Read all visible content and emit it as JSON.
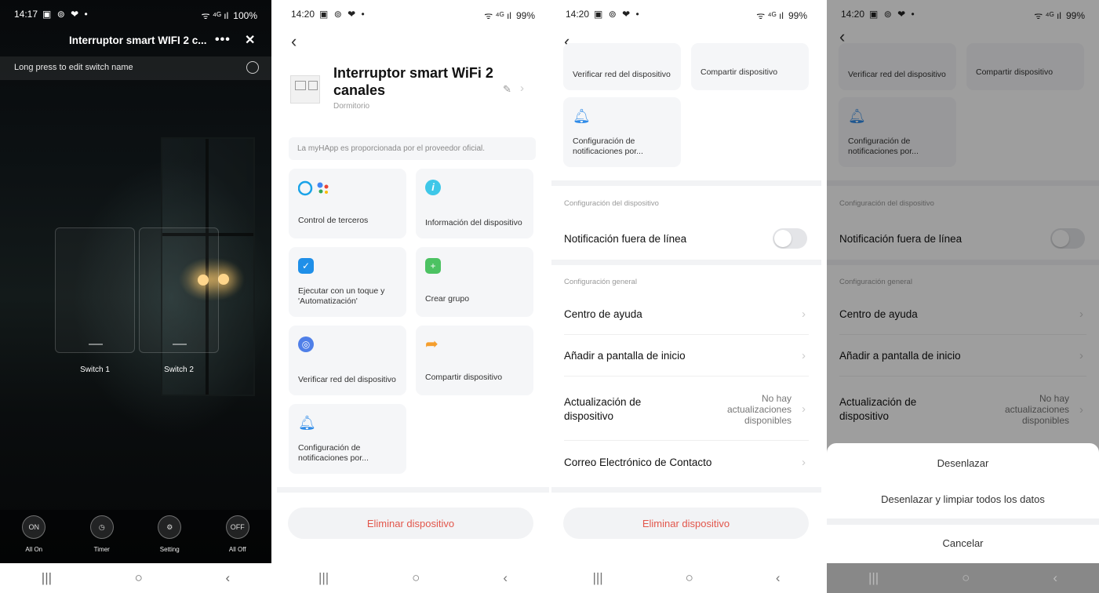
{
  "screen1": {
    "status": {
      "time": "14:17",
      "icons": "▣ ⊚ ❤ •",
      "signal": "ᯤ ⁴ᴳ ıl",
      "battery": "100%"
    },
    "title": "Interruptor smart WIFI 2 c...",
    "more_icon": "•••",
    "close_icon": "✕",
    "hint": "Long press to edit switch name",
    "switches": [
      "Switch 1",
      "Switch 2"
    ],
    "controls": [
      {
        "icon_text": "ON",
        "label": "All On"
      },
      {
        "icon_text": "◷",
        "label": "Timer"
      },
      {
        "icon_text": "⚙",
        "label": "Setting"
      },
      {
        "icon_text": "OFF",
        "label": "All Off"
      }
    ],
    "nav": {
      "recent": "|||",
      "home": "○",
      "back": "‹"
    }
  },
  "screen2": {
    "status": {
      "time": "14:20",
      "icons": "▣ ⊚ ❤ •",
      "signal": "ᯤ ⁴ᴳ ıl",
      "battery": "99%"
    },
    "back_icon": "‹",
    "device_name": "Interruptor smart WiFi 2 canales",
    "device_room": "Dormitorio",
    "edit_icon": "✎",
    "chevron": "›",
    "provider_text": "La myHApp es proporcionada por el proveedor oficial.",
    "tiles": [
      {
        "label": "Control de terceros",
        "icon": "alexa-google-icon",
        "color": "#1a73e8"
      },
      {
        "label": "Información del dispositivo",
        "icon": "info-icon",
        "color": "#3ec7e8"
      },
      {
        "label": "Ejecutar con un toque y 'Automatización'",
        "icon": "check-shield-icon",
        "color": "#1f8fe8"
      },
      {
        "label": "Crear grupo",
        "icon": "group-add-icon",
        "color": "#4cc262"
      },
      {
        "label": "Verificar red del dispositivo",
        "icon": "network-check-icon",
        "color": "#4f7fe8"
      },
      {
        "label": "Compartir dispositivo",
        "icon": "share-arrow-icon",
        "color": "#f59e2d"
      },
      {
        "label": "Configuración de notificaciones por...",
        "icon": "bell-icon",
        "color": "#2f8be8"
      }
    ],
    "delete_label": "Eliminar dispositivo",
    "nav": {
      "recent": "|||",
      "home": "○",
      "back": "‹"
    }
  },
  "screen3": {
    "status": {
      "time": "14:20",
      "icons": "▣ ⊚ ❤ •",
      "signal": "ᯤ ⁴ᴳ ıl",
      "battery": "99%"
    },
    "back_icon": "‹",
    "top_tiles": [
      {
        "label": "Verificar red del dispositivo"
      },
      {
        "label": "Compartir dispositivo"
      },
      {
        "label": "Configuración de notificaciones por..."
      }
    ],
    "device_settings_header": "Configuración del dispositivo",
    "offline_notification": "Notificación fuera de línea",
    "general_header": "Configuración general",
    "help_center": "Centro de ayuda",
    "add_home": "Añadir a pantalla de inicio",
    "update_label": "Actualización de dispositivo",
    "update_value": "No hay actualizaciones disponibles",
    "contact_email": "Correo Electrónico de Contacto",
    "delete_label": "Eliminar dispositivo",
    "chevron": "›",
    "nav": {
      "recent": "|||",
      "home": "○",
      "back": "‹"
    }
  },
  "screen4": {
    "status": {
      "time": "14:20",
      "icons": "▣ ⊚ ❤ •",
      "signal": "ᯤ ⁴ᴳ ıl",
      "battery": "99%"
    },
    "back_icon": "‹",
    "top_tiles": [
      {
        "label": "Verificar red del dispositivo"
      },
      {
        "label": "Compartir dispositivo"
      },
      {
        "label": "Configuración de notificaciones por..."
      }
    ],
    "device_settings_header": "Configuración del dispositivo",
    "offline_notification": "Notificación fuera de línea",
    "general_header": "Configuración general",
    "help_center": "Centro de ayuda",
    "add_home": "Añadir a pantalla de inicio",
    "update_label": "Actualización de dispositivo",
    "update_value": "No hay actualizaciones disponibles",
    "chevron": "›",
    "sheet": {
      "unlink": "Desenlazar",
      "unlink_wipe": "Desenlazar y limpiar todos los datos",
      "cancel": "Cancelar"
    },
    "nav": {
      "recent": "|||",
      "home": "○",
      "back": "‹"
    }
  }
}
